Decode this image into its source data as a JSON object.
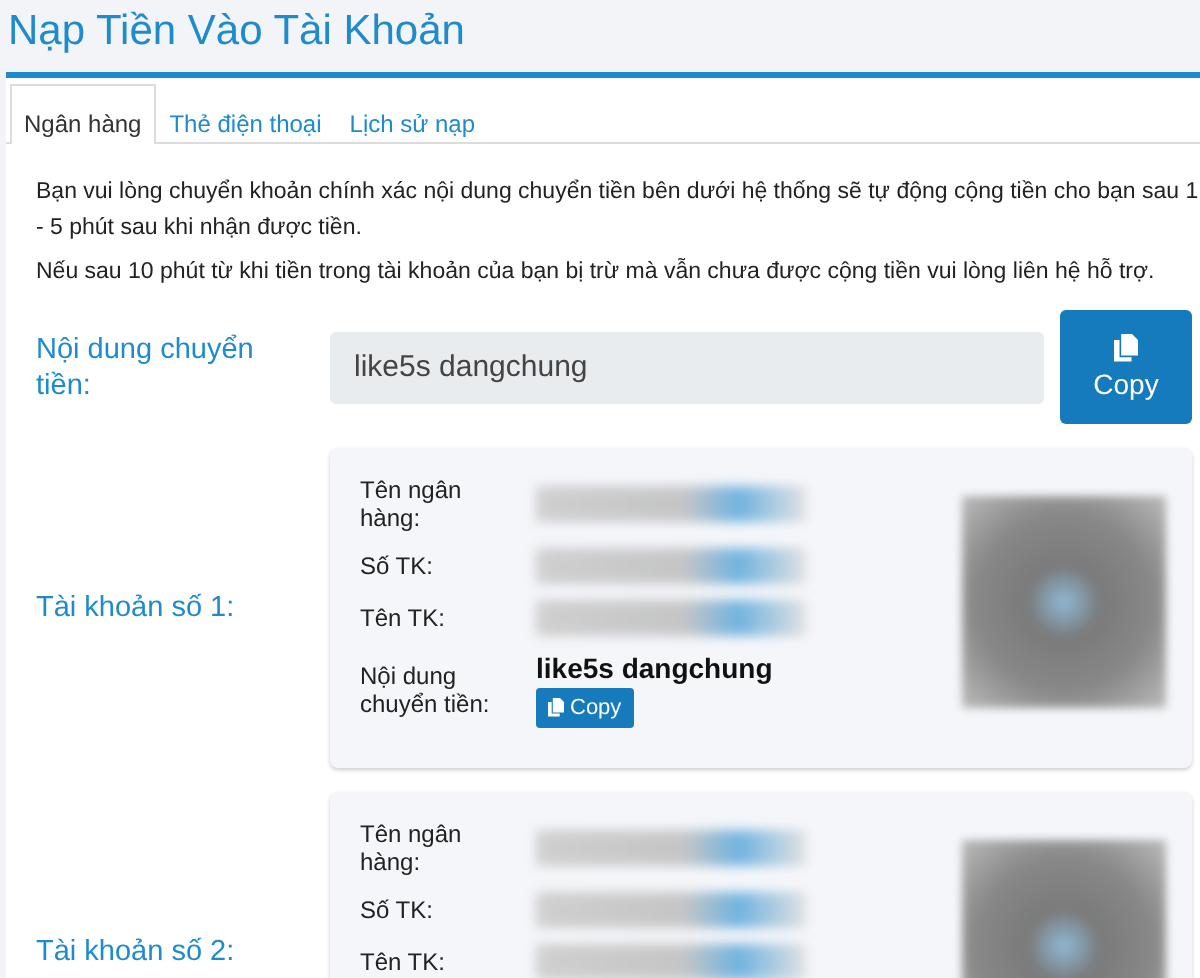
{
  "title": "Nạp Tiền Vào Tài Khoản",
  "tabs": [
    {
      "label": "Ngân hàng",
      "selected": true
    },
    {
      "label": "Thẻ điện thoại",
      "selected": false
    },
    {
      "label": "Lịch sử nạp",
      "selected": false
    }
  ],
  "notice": [
    "Bạn vui lòng chuyển khoản chính xác nội dung chuyển tiền bên dưới hệ thống sẽ tự động cộng tiền cho bạn sau 1 - 5 phút sau khi nhận được tiền.",
    "Nếu sau 10 phút từ khi tiền trong tài khoản của bạn bị trừ mà vẫn chưa được cộng tiền vui lòng liên hệ hỗ trợ."
  ],
  "transfer_content": {
    "label": "Nội dung chuyển tiền:",
    "value": "like5s dangchung",
    "button": "Copy"
  },
  "accounts": [
    {
      "label": "Tài khoản số 1:",
      "fields": [
        {
          "kind": "redacted",
          "label": "Tên ngân hàng:"
        },
        {
          "kind": "redacted",
          "label": "Số TK:"
        },
        {
          "kind": "redacted",
          "label": "Tên TK:"
        },
        {
          "kind": "content",
          "label": "Nội dung chuyển tiền:",
          "value": "like5s dangchung",
          "button": "Copy"
        }
      ]
    },
    {
      "label": "Tài khoản số 2:",
      "fields": [
        {
          "kind": "redacted",
          "label": "Tên ngân hàng:"
        },
        {
          "kind": "redacted",
          "label": "Số TK:"
        },
        {
          "kind": "redacted",
          "label": "Tên TK:"
        }
      ]
    }
  ]
}
